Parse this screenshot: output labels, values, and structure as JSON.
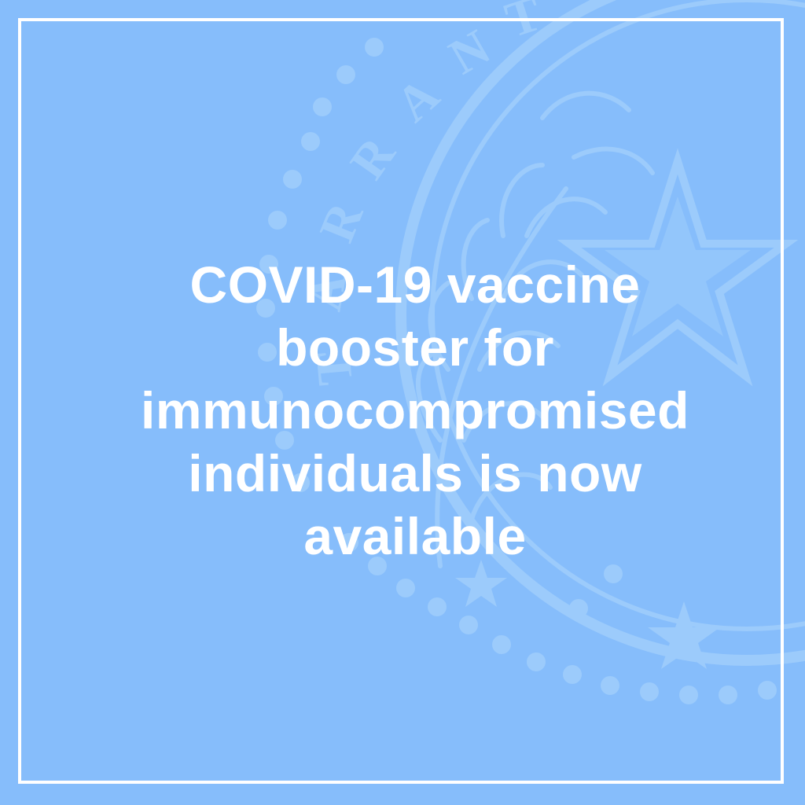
{
  "background_color": "#86bdfb",
  "watermark_color": "#9ccbfb",
  "text_color": "#ffffff",
  "seal": {
    "icon": "county-seal-watermark-icon",
    "letters": [
      "T",
      "A",
      "R",
      "R",
      "A",
      "N",
      "T"
    ]
  },
  "headline": {
    "line1": "COVID-19 vaccine",
    "line2": "booster for",
    "line3": "immunocompromised",
    "line4": "individuals is now",
    "line5": "available"
  }
}
